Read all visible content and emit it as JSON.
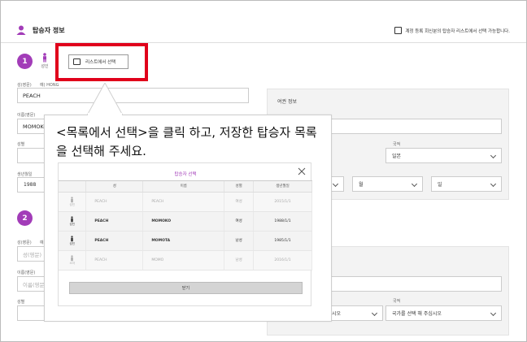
{
  "header": {
    "title": "탑승자 정보",
    "note": "계정 등록 회신분의 탑승자 리스트에서 선택 가능합니다."
  },
  "passenger1": {
    "step": "1",
    "gender_label": "성인",
    "list_button": "리스트에서 선택",
    "surname_label": "성(영문)",
    "surname_example": "예) HONG",
    "surname_value": "PEACH",
    "given_label": "이름(영문)",
    "given_value": "MOMOKO",
    "sex_label": "성별",
    "birth_label": "생년월일",
    "birth_value": "1988"
  },
  "passport_panel": {
    "title": "여권 정보",
    "nationality_label": "국적",
    "nationality_value": "일본",
    "month_value": "월",
    "day_value": "일"
  },
  "passenger2": {
    "step": "2",
    "surname_label": "성(영문)",
    "surname_example": "예",
    "surname_placeholder": "성(영문)",
    "given_label": "이름(영문)",
    "given_placeholder": "이름(영문)",
    "sex_label": "성별"
  },
  "panel2": {
    "nationality_label": "국적",
    "select_left_value": "주십시오",
    "nationality_placeholder": "국가를 선택 해 주십시오"
  },
  "callout": {
    "text": "<목록에서 선택>을 클릭 하고, 저장한 탑승자 목록을 선택해 주세요."
  },
  "modal": {
    "title": "탑승자 선택",
    "columns": [
      "",
      "성",
      "이름",
      "성별",
      "생년월일"
    ],
    "rows": [
      {
        "type": "성인",
        "surname": "PEACH",
        "given": "PEACH",
        "sex": "여성",
        "birth": "2015/1/1",
        "state": "dim"
      },
      {
        "type": "성인",
        "surname": "PEACH",
        "given": "MOMOKO",
        "sex": "여성",
        "birth": "1988/1/1",
        "state": "act"
      },
      {
        "type": "성인",
        "surname": "PEACH",
        "given": "MOMOTA",
        "sex": "남성",
        "birth": "1985/1/1",
        "state": "act"
      },
      {
        "type": "소아",
        "surname": "PEACH",
        "given": "MOMO",
        "sex": "남성",
        "birth": "2016/1/1",
        "state": "dim"
      }
    ],
    "close_label": "닫기"
  },
  "colors": {
    "accent": "#a23cb8",
    "highlight": "#e0001b"
  },
  "icons": [
    "person-icon",
    "list-icon",
    "close-icon",
    "chevron-down-icon"
  ]
}
